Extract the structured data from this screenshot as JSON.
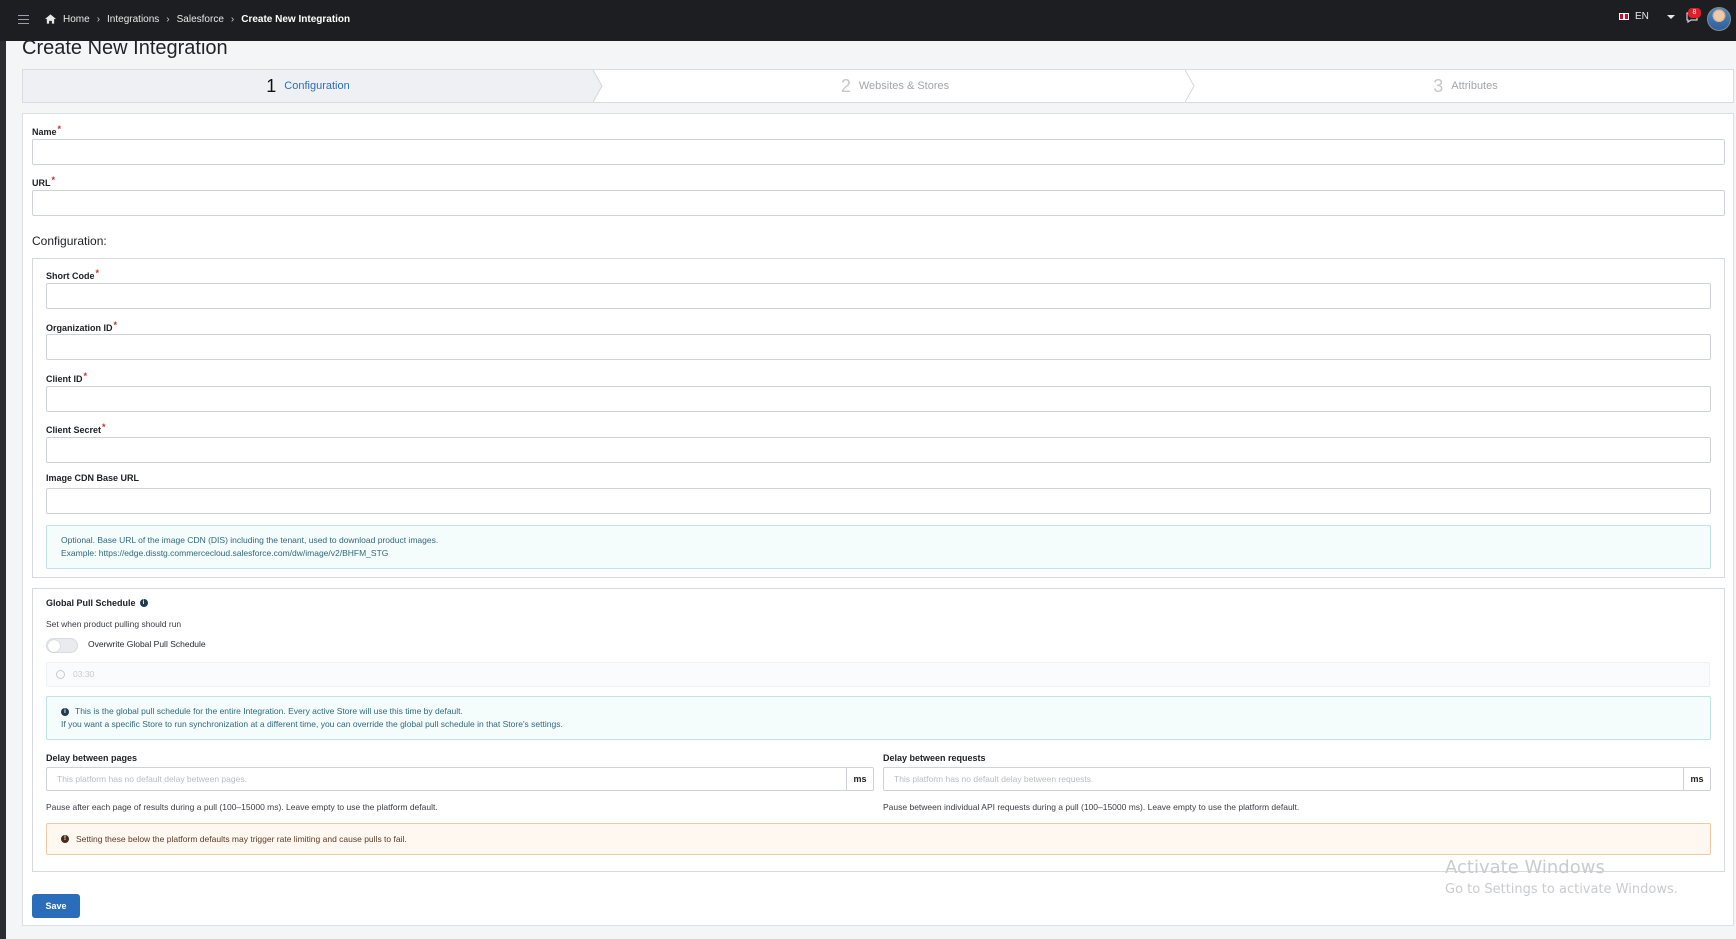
{
  "breadcrumb": [
    "Home",
    "Integrations",
    "Salesforce",
    "Create New Integration"
  ],
  "topbar": {
    "language": "EN",
    "notification_count": "8"
  },
  "page": {
    "title": "Create New Integration"
  },
  "stepper": [
    {
      "num": "1",
      "label": "Configuration",
      "active": true
    },
    {
      "num": "2",
      "label": "Websites & Stores",
      "active": false
    },
    {
      "num": "3",
      "label": "Attributes",
      "active": false
    }
  ],
  "form": {
    "name_label": "Name",
    "url_label": "URL",
    "required_mark": "*",
    "config_title": "Configuration:",
    "short_code_label": "Short Code",
    "org_id_label": "Organization ID",
    "client_id_label": "Client ID",
    "client_secret_label": "Client Secret",
    "image_cdn_label": "Image CDN Base URL",
    "image_cdn_help_1": "Optional. Base URL of the image CDN (DIS) including the tenant, used to download product images.",
    "image_cdn_help_2": "Example: https://edge.disstg.commercecloud.salesforce.com/dw/image/v2/BHFM_STG"
  },
  "schedule": {
    "title": "Global Pull Schedule",
    "subtitle": "Set when product pulling should run",
    "toggle_label": "Overwrite Global Pull Schedule",
    "time_value": "03:30",
    "info_1": "This is the global pull schedule for the entire Integration. Every active Store will use this time by default.",
    "info_2": "If you want a specific Store to run synchronization at a different time, you can override the global pull schedule in that Store's settings.",
    "delay_pages_label": "Delay between pages",
    "delay_pages_placeholder": "This platform has no default delay between pages.",
    "delay_pages_help": "Pause after each page of results during a pull (100–15000 ms). Leave empty to use the platform default.",
    "delay_requests_label": "Delay between requests",
    "delay_requests_placeholder": "This platform has no default delay between requests.",
    "delay_requests_help": "Pause between individual API requests during a pull (100–15000 ms). Leave empty to use the platform default.",
    "unit": "ms",
    "warning": "Setting these below the platform defaults may trigger rate limiting and cause pulls to fail."
  },
  "actions": {
    "save": "Save"
  },
  "watermark": {
    "line1": "Activate Windows",
    "line2": "Go to Settings to activate Windows."
  }
}
